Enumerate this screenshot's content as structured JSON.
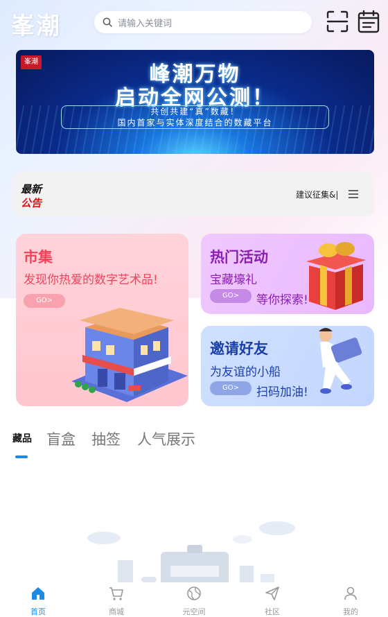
{
  "header": {
    "logo_text": "峯潮",
    "search_placeholder": "请输入关键词",
    "scan_icon": "scan-icon",
    "calendar_icon": "calendar-icon"
  },
  "banner": {
    "badge": "峯潮",
    "line1": "峰潮万物",
    "line2": "启动全网公测！",
    "sub1": "共创共建“真”数藏！",
    "sub2": "国内首家与实体深度结合的数藏平台"
  },
  "notice": {
    "label_top": "最新",
    "label_bottom": "公告",
    "text": "建议征集&|",
    "menu_icon": "menu-icon"
  },
  "cards": {
    "market": {
      "title": "市集",
      "subtitle": "发现你热爱的数字艺术品!",
      "button": "GO>"
    },
    "hot": {
      "title": "热门活动",
      "subtitle": "宝藏壕礼",
      "tagline": "等你探索!",
      "button": "GO>"
    },
    "invite": {
      "title": "邀请好友",
      "subtitle": "为友谊的小船",
      "tagline": "扫码加油!",
      "button": "GO>"
    }
  },
  "tabs": [
    {
      "label": "藏品",
      "active": true
    },
    {
      "label": "盲盒",
      "active": false
    },
    {
      "label": "抽签",
      "active": false
    },
    {
      "label": "人气展示",
      "active": false
    }
  ],
  "nav": [
    {
      "label": "首页",
      "icon": "home-icon",
      "active": true
    },
    {
      "label": "商城",
      "icon": "cart-icon",
      "active": false
    },
    {
      "label": "元空间",
      "icon": "globe-icon",
      "active": false
    },
    {
      "label": "社区",
      "icon": "send-icon",
      "active": false
    },
    {
      "label": "我的",
      "icon": "user-icon",
      "active": false
    }
  ],
  "colors": {
    "accent": "#1e8ae6",
    "market_title": "#f0445a",
    "hot_title": "#8a1fb5",
    "invite_title": "#1b3fa8",
    "notice_red": "#e0101a"
  }
}
